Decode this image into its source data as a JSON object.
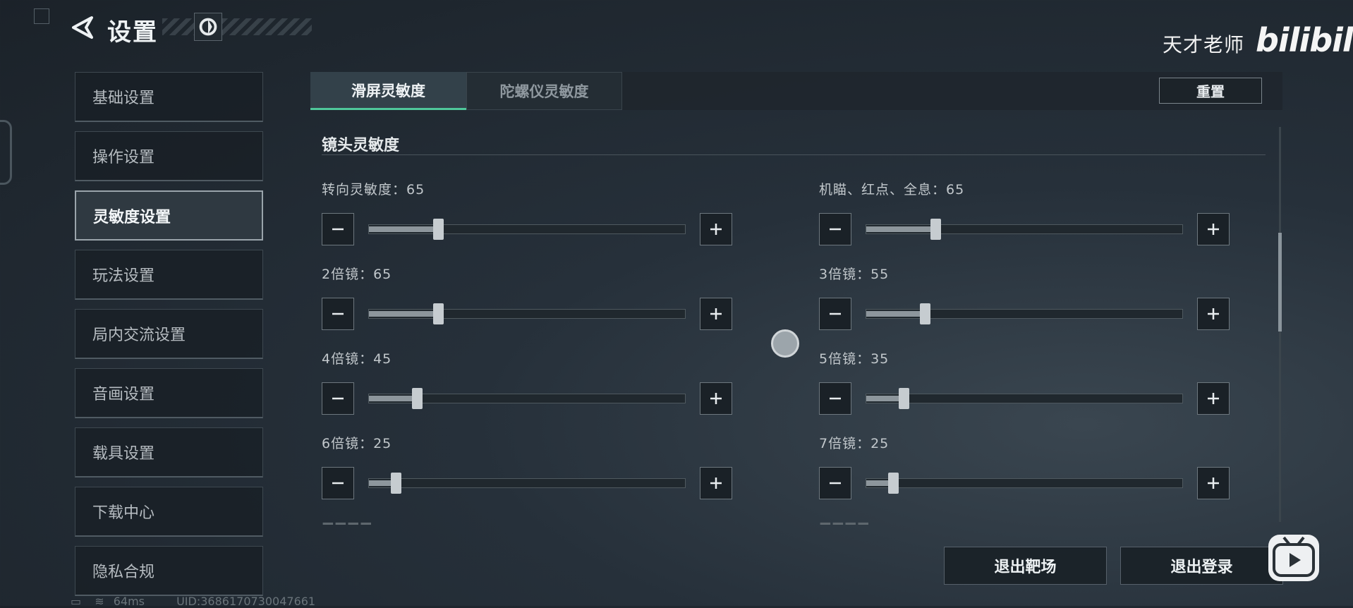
{
  "header": {
    "title": "设置",
    "back_icon": "back-arrow-icon",
    "logo_icon": "game-logo-icon"
  },
  "watermark": {
    "text": "天才老师",
    "logo": "bilibili"
  },
  "sidebar": {
    "items": [
      {
        "label": "基础设置",
        "active": false
      },
      {
        "label": "操作设置",
        "active": false
      },
      {
        "label": "灵敏度设置",
        "active": true
      },
      {
        "label": "玩法设置",
        "active": false
      },
      {
        "label": "局内交流设置",
        "active": false
      },
      {
        "label": "音画设置",
        "active": false
      },
      {
        "label": "载具设置",
        "active": false
      },
      {
        "label": "下载中心",
        "active": false
      },
      {
        "label": "隐私合规",
        "active": false
      }
    ]
  },
  "tabs": [
    {
      "label": "滑屏灵敏度",
      "active": true
    },
    {
      "label": "陀螺仪灵敏度",
      "active": false
    }
  ],
  "reset_label": "重置",
  "section_title": "镜头灵敏度",
  "sliders": [
    {
      "label": "转向灵敏度：65",
      "value": 65
    },
    {
      "label": "机瞄、红点、全息：65",
      "value": 65
    },
    {
      "label": "2倍镜：65",
      "value": 65
    },
    {
      "label": "3倍镜：55",
      "value": 55
    },
    {
      "label": "4倍镜：45",
      "value": 45
    },
    {
      "label": "5倍镜：35",
      "value": 35
    },
    {
      "label": "6倍镜：25",
      "value": 25
    },
    {
      "label": "7倍镜：25",
      "value": 25
    }
  ],
  "slider_max": 300,
  "buttons": {
    "exit_range": "退出靶场",
    "logout": "退出登录"
  },
  "status": {
    "ping": "64ms",
    "uid": "UID:3686170730047661"
  },
  "colors": {
    "accent": "#4fc79a",
    "background": "#1f2830"
  }
}
